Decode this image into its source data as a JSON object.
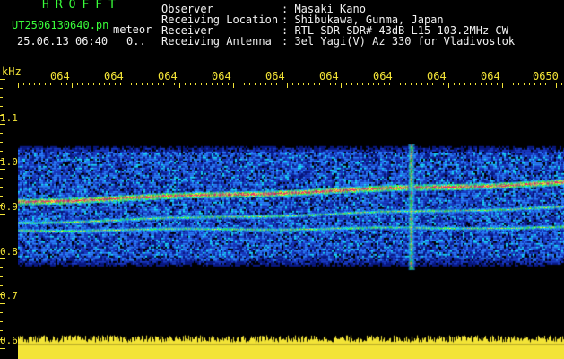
{
  "header": {
    "brand": "HROFFT",
    "filename": "UT2506130640.pn",
    "meteor_label": "meteor",
    "date_time": "25.06.13 06:40",
    "count": "0..",
    "meta": [
      {
        "label": "Observer",
        "value": ": Masaki Kano"
      },
      {
        "label": "Receiving Location",
        "value": ": Shibukawa, Gunma, Japan"
      },
      {
        "label": "Receiver",
        "value": ": RTL-SDR SDR# 43dB L15 103.2MHz CW"
      },
      {
        "label": "Receiving Antenna",
        "value": ": 3el Yagi(V) Az 330 for Vladivostok"
      }
    ]
  },
  "colors": {
    "green": "#39ff3a",
    "yellow": "#f3e437",
    "white": "#f2f2f2",
    "background": "#000000"
  },
  "chart_data": {
    "type": "heatmap",
    "ylabel": "kHz",
    "yticks": [
      "1.1",
      "1.0",
      "0.9",
      "0.8",
      "0.7",
      "0.6"
    ],
    "ylim": [
      0.6,
      1.15
    ],
    "xticks": [
      "064",
      "064",
      "064",
      "064",
      "064",
      "064",
      "064",
      "064",
      "064",
      "0650"
    ],
    "signals": [
      {
        "kind": "carrier",
        "freq_start": 0.912,
        "freq_end": 0.955,
        "intensity": "strong"
      },
      {
        "kind": "carrier",
        "freq_start": 0.865,
        "freq_end": 0.9,
        "intensity": "medium"
      },
      {
        "kind": "carrier",
        "freq_start": 0.848,
        "freq_end": 0.855,
        "intensity": "medium"
      },
      {
        "kind": "meteor-burst",
        "position": 0.72,
        "freq_range": [
          0.76,
          1.04
        ]
      }
    ],
    "noise_band": [
      0.79,
      1.02
    ],
    "bottom_band": [
      0.58,
      0.605
    ]
  }
}
